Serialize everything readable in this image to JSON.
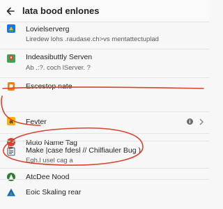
{
  "header": {
    "back_icon": "back-arrow-icon",
    "title": "lata bood enlones"
  },
  "items": [
    {
      "icon": "google-drive-icon",
      "title": "Lovielserverg",
      "subtitle": "Liredew lohs .raudase.ch>vs mentattectuplad"
    },
    {
      "icon": "maps-pin-icon",
      "title": "Indeasibuttly Serven",
      "subtitle": "Ab .:?. coch  lServer. ?"
    },
    {
      "icon": "orange-app-icon",
      "title": "Escestop nate",
      "subtitle": ""
    },
    {
      "icon": "amazon-icon",
      "title": "Fevter",
      "subtitle": "",
      "badge": "i"
    },
    {
      "icon": "red-tag-icon",
      "title": "Muto Name Tag",
      "subtitle": ""
    },
    {
      "icon": "clipboard-icon",
      "title": "Make |case fdesl // Chilfiauler Bug )",
      "subtitle": "Egh.l usel cag a"
    },
    {
      "icon": "atcdee-logo-icon",
      "title": "AtcDee Nood",
      "subtitle": ""
    },
    {
      "icon": "triangle-logo-icon",
      "title": "Eoic Skaling rear",
      "subtitle": ""
    }
  ],
  "colors": {
    "annotation_red": "#d8432f",
    "accent_blue": "#1a73e8"
  }
}
